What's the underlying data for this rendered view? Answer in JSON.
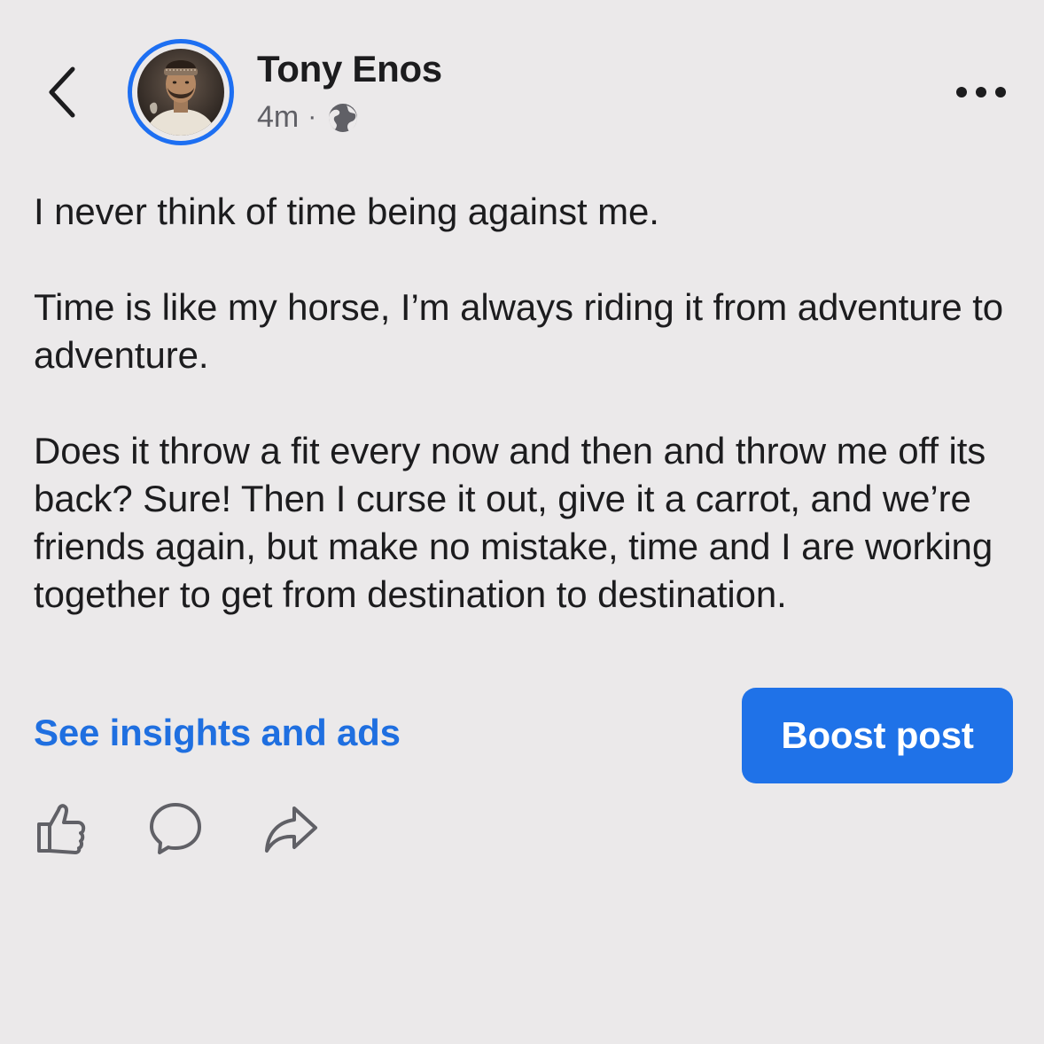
{
  "header": {
    "back_icon": "chevron-left-icon",
    "author_name": "Tony Enos",
    "timestamp": "4m",
    "separator": "·",
    "audience_icon": "globe-icon",
    "more_icon": "ellipsis-icon",
    "avatar_ring_color": "#1d6ff2"
  },
  "post": {
    "paragraphs": [
      "I never think of time being against me.",
      "Time is like my horse, I’m always riding it from adventure to adventure.",
      "Does it throw a fit every now and then and throw me off its back? Sure! Then I curse it out, give it a carrot, and we’re friends again, but make no mistake, time and I are working together to get from destination to destination."
    ]
  },
  "footer": {
    "insights_link": "See insights and ads",
    "boost_button": "Boost post",
    "link_color": "#1f6fe0",
    "button_color": "#1f72e8"
  },
  "actions": [
    {
      "icon": "thumbs-up-icon"
    },
    {
      "icon": "comment-icon"
    },
    {
      "icon": "share-icon"
    }
  ],
  "colors": {
    "background": "#ebe9ea",
    "text": "#1c1c1e",
    "secondary_text": "#606066"
  }
}
